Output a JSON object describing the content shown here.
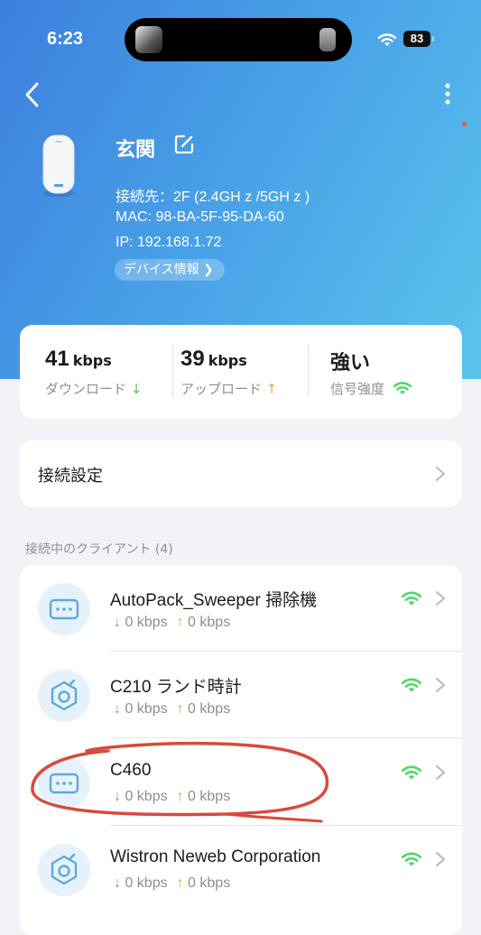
{
  "status_bar": {
    "time": "6:23",
    "battery": "83"
  },
  "device": {
    "name": "玄関",
    "connected_to": "接続先：2F (2.4GH z /5GH z )",
    "mac": "MAC: 98-BA-5F-95-DA-60",
    "ip": "IP: 192.168.1.72",
    "info_button": "デバイス情報 ❯"
  },
  "stats": {
    "download_value": "41",
    "download_unit": "kbps",
    "download_label": "ダウンロード",
    "upload_value": "39",
    "upload_unit": "kbps",
    "upload_label": "アップロード",
    "signal_value": "強い",
    "signal_label": "信号強度"
  },
  "settings": {
    "connection_label": "接続設定"
  },
  "clients": {
    "section_title": "接続中のクライアント (4)",
    "items": [
      {
        "name": "AutoPack_Sweeper 掃除機",
        "down": "0 kbps",
        "up": "0 kbps",
        "icon": "generic-device-icon"
      },
      {
        "name": "C210 ランド時計",
        "down": "0 kbps",
        "up": "0 kbps",
        "icon": "camera-icon"
      },
      {
        "name": "C460",
        "down": "0 kbps",
        "up": "0 kbps",
        "icon": "generic-device-icon"
      },
      {
        "name": "Wistron Neweb Corporation",
        "down": "0 kbps",
        "up": "0 kbps",
        "icon": "camera-icon"
      }
    ]
  },
  "colors": {
    "accent": "#3d7fde",
    "download_arrow": "#5ac05c",
    "upload_arrow": "#f0a33b",
    "signal": "#4cd964",
    "annotation": "#d84a3a"
  }
}
